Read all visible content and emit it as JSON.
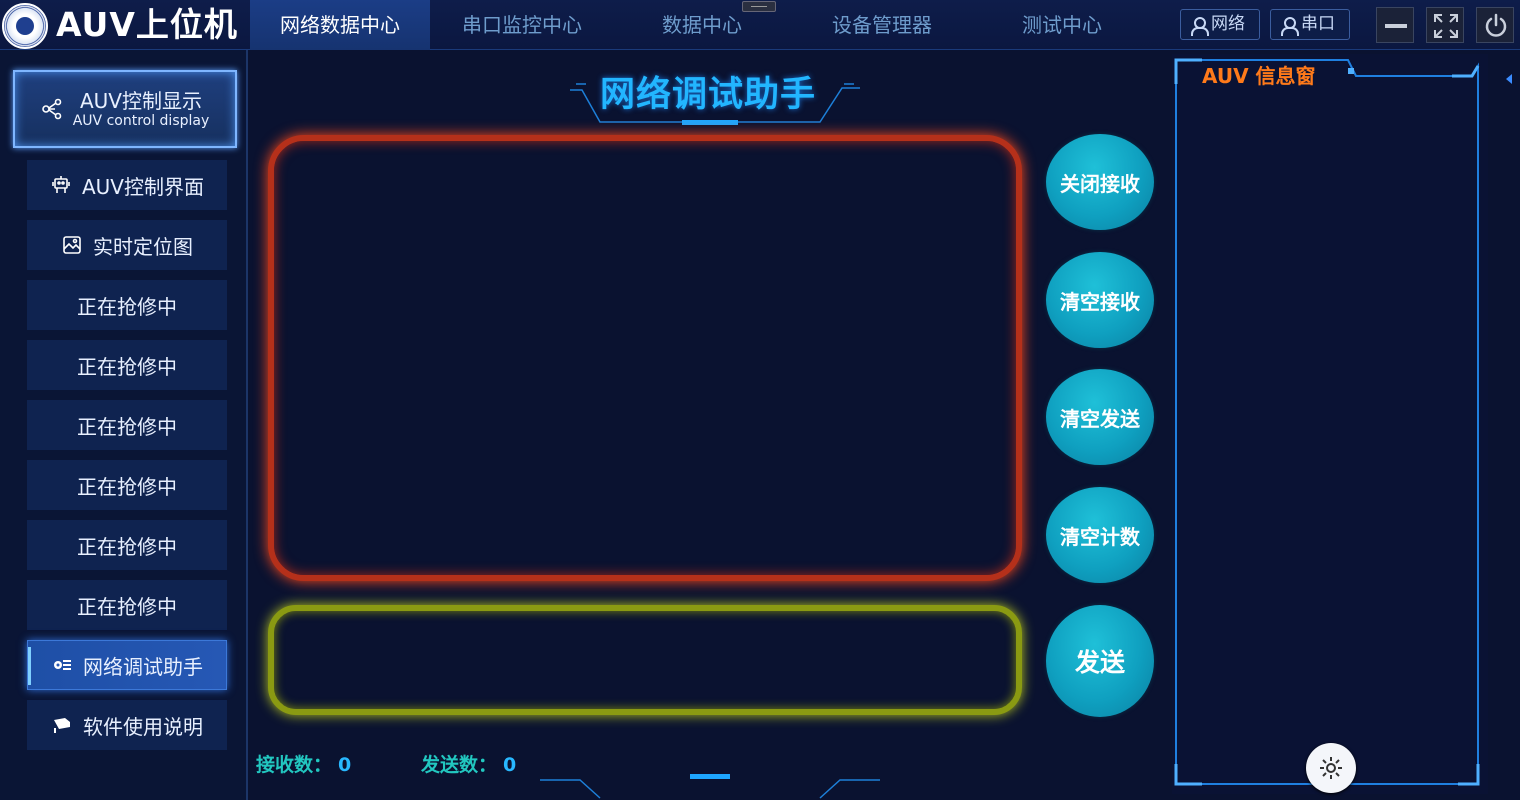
{
  "app": {
    "title": "AUV上位机"
  },
  "nav": {
    "tabs": [
      {
        "label": "网络数据中心",
        "active": true
      },
      {
        "label": "串口监控中心",
        "active": false
      },
      {
        "label": "数据中心",
        "active": false
      },
      {
        "label": "设备管理器",
        "active": false
      },
      {
        "label": "测试中心",
        "active": false
      }
    ],
    "network_btn": "网络",
    "serial_btn": "串口"
  },
  "sidebar": {
    "primary": {
      "label": "AUV控制显示",
      "sublabel": "AUV control display",
      "icon": "control-nodes-icon"
    },
    "items": [
      {
        "label": "AUV控制界面",
        "icon": "robot-icon"
      },
      {
        "label": "实时定位图",
        "icon": "map-image-icon"
      },
      {
        "label": "正在抢修中"
      },
      {
        "label": "正在抢修中"
      },
      {
        "label": "正在抢修中"
      },
      {
        "label": "正在抢修中"
      },
      {
        "label": "正在抢修中"
      },
      {
        "label": "正在抢修中"
      },
      {
        "label": "网络调试助手",
        "icon": "gear-list-icon",
        "active": true
      },
      {
        "label": "软件使用说明",
        "icon": "flag-icon"
      }
    ]
  },
  "main": {
    "title": "网络调试助手",
    "receive_area": "",
    "send_area": "",
    "buttons": {
      "close_receive": "关闭接收",
      "clear_receive": "清空接收",
      "clear_send": "清空发送",
      "clear_count": "清空计数",
      "send": "发送"
    },
    "counters": {
      "received_label": "接收数：",
      "received_value": "0",
      "sent_label": "发送数：",
      "sent_value": "0"
    }
  },
  "info_panel": {
    "title": "AUV 信息窗"
  },
  "colors": {
    "accent": "#22b6ff",
    "receive_border": "#b5301a",
    "send_border": "#8a9a12",
    "round_button": "#0fa0c0",
    "info_title": "#ff7a1a",
    "counter_label": "#22c7c0"
  }
}
